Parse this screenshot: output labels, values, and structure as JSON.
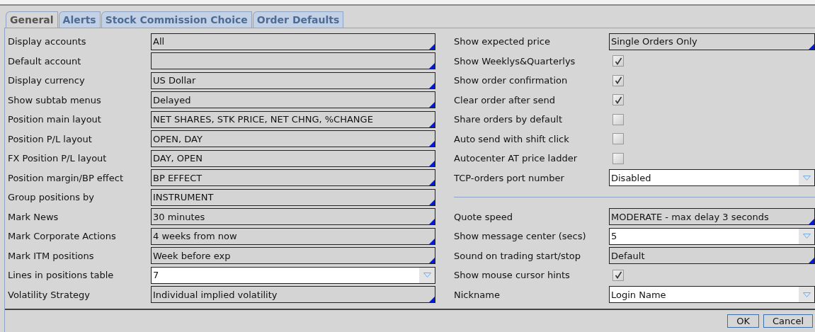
{
  "tabs": [
    {
      "label": "General",
      "selected": true
    },
    {
      "label": "Alerts",
      "selected": false
    },
    {
      "label": "Stock Commission Choice",
      "selected": false
    },
    {
      "label": "Order Defaults",
      "selected": false
    }
  ],
  "left_settings": [
    {
      "label": "Display accounts",
      "kind": "menu",
      "value": "All"
    },
    {
      "label": "Default account",
      "kind": "menu"
    },
    {
      "label": "Display currency",
      "kind": "menu",
      "value": "US Dollar"
    },
    {
      "label": "Show subtab menus",
      "kind": "menu",
      "value": "Delayed"
    },
    {
      "label": "Position main layout",
      "kind": "menu",
      "value": "NET SHARES, STK PRICE, NET CHNG, %CHANGE"
    },
    {
      "label": "Position P/L layout",
      "kind": "menu",
      "value": "OPEN, DAY"
    },
    {
      "label": "FX Position P/L layout",
      "kind": "menu",
      "value": "DAY, OPEN"
    },
    {
      "label": "Position margin/BP effect",
      "kind": "menu",
      "value": "BP EFFECT"
    },
    {
      "label": "Group positions by",
      "kind": "menu",
      "value": "INSTRUMENT"
    },
    {
      "label": "Mark News",
      "kind": "menu",
      "value": "30 minutes"
    },
    {
      "label": "Mark Corporate Actions",
      "kind": "menu",
      "value": "4 weeks from now"
    },
    {
      "label": "Mark ITM positions",
      "kind": "menu",
      "value": "Week before exp"
    },
    {
      "label": "Lines in positions table",
      "kind": "dropdown",
      "value": "7"
    },
    {
      "label": "Volatility Strategy",
      "kind": "menu",
      "value": "Individual implied volatility"
    }
  ],
  "right_settings": [
    {
      "label": "Show expected price",
      "kind": "menu",
      "value": "Single Orders Only"
    },
    {
      "label": "Show Weeklys&Quarterlys",
      "kind": "checkbox",
      "checked": true
    },
    {
      "label": "Show order confirmation",
      "kind": "checkbox",
      "checked": true
    },
    {
      "label": "Clear order after send",
      "kind": "checkbox",
      "checked": true
    },
    {
      "label": "Share orders by default",
      "kind": "checkbox",
      "checked": false
    },
    {
      "label": "Auto send with shift click",
      "kind": "checkbox",
      "checked": false
    },
    {
      "label": "Autocenter AT price ladder",
      "kind": "checkbox",
      "checked": false
    },
    {
      "label": "TCP-orders port number",
      "kind": "dropdown",
      "value": "Disabled"
    },
    {
      "kind": "separator"
    },
    {
      "label": "Quote speed",
      "kind": "menu",
      "value": "MODERATE - max delay 3 seconds"
    },
    {
      "label": "Show message center (secs)",
      "kind": "dropdown",
      "value": "5"
    },
    {
      "label": "Sound on trading start/stop",
      "kind": "menu",
      "value": "Default"
    },
    {
      "label": "Show mouse cursor hints",
      "kind": "checkbox",
      "checked": true
    },
    {
      "label": "Nickname",
      "kind": "dropdown",
      "value": "Login Name"
    }
  ],
  "buttons": [
    "OK",
    "Cancel"
  ]
}
